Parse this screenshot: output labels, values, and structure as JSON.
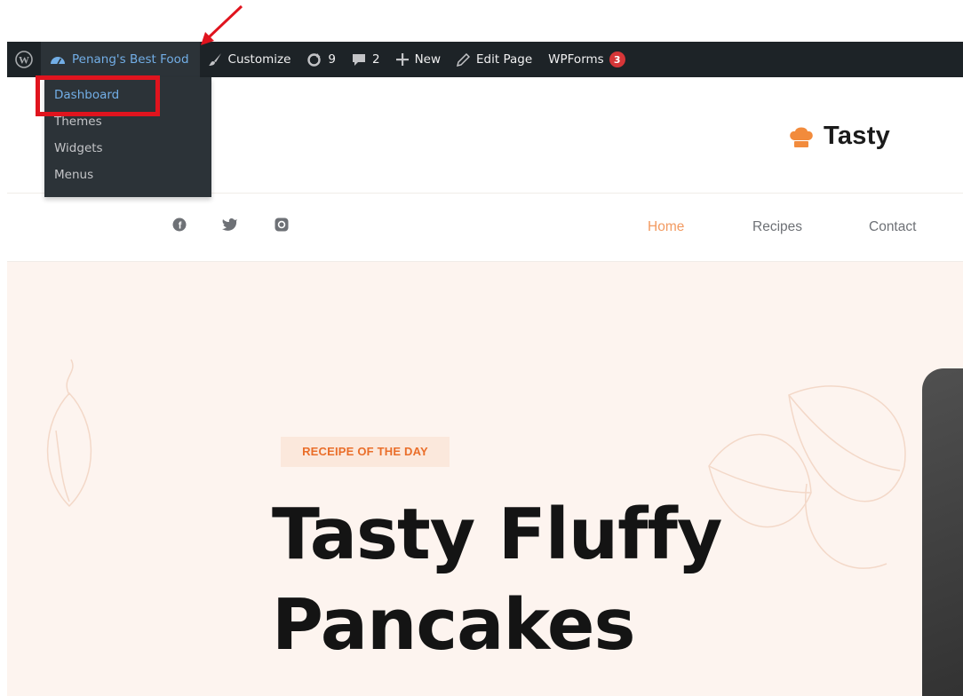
{
  "admin_bar": {
    "site_name": "Penang's Best Food",
    "customize": "Customize",
    "updates_count": "9",
    "comments_count": "2",
    "new_label": "New",
    "edit_page": "Edit Page",
    "wpforms": "WPForms",
    "wpforms_badge": "3"
  },
  "site_menu": {
    "items": [
      {
        "label": "Dashboard"
      },
      {
        "label": "Themes"
      },
      {
        "label": "Widgets"
      },
      {
        "label": "Menus"
      }
    ]
  },
  "header": {
    "logo_text": "Tasty"
  },
  "nav": {
    "social_icons": [
      "facebook-icon",
      "twitter-icon",
      "instagram-icon"
    ],
    "links": [
      {
        "label": "Home",
        "active": true
      },
      {
        "label": "Recipes",
        "active": false
      },
      {
        "label": "Contact",
        "active": false
      }
    ]
  },
  "hero": {
    "tag": "RECEIPE OF THE DAY",
    "title_line1": "Tasty Fluffy",
    "title_line2": "Pancakes"
  },
  "colors": {
    "admin_bar_bg": "#1d2327",
    "link_blue": "#72aee6",
    "badge_red": "#d63638",
    "accent_orange": "#f29a61",
    "hero_bg": "#fdf4ef",
    "highlight_red": "#e0141e"
  }
}
